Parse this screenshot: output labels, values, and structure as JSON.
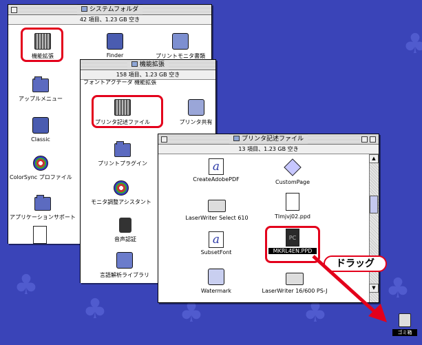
{
  "desktop": {
    "bg_color": "#3a44b8",
    "trash_label": "ゴミ箱"
  },
  "win_system": {
    "title": "システムフォルダ",
    "info": "42 項目、1.23 GB 空き",
    "items": {
      "kinou": "機能拡張",
      "finder": "Finder",
      "printmon": "プリントモニタ書類",
      "applemenu": "アップルメニュー",
      "classic": "Classic",
      "colorsync": "ColorSync プロファイル",
      "appsupport": "アプリケーションサポート"
    }
  },
  "win_ext": {
    "title": "機能拡張",
    "info": "158 項目、1.23 GB 空き",
    "partial_row": "フォントアクテーダ 機能拡張",
    "items": {
      "ppd": "プリンタ記述ファイル",
      "share": "プリンタ共有",
      "plugin": "プリントプラグイン",
      "monitor": "モニタ調整アシスタント",
      "voice": "音声認証",
      "lang": "言語解析ライブラリ"
    }
  },
  "win_ppd": {
    "title": "プリンタ記述ファイル",
    "info": "13 項目、1.23 GB 空き",
    "items": {
      "createadobe": "CreateAdobePDF",
      "custompage": "CustomPage",
      "lw610": "LaserWriter Select 610",
      "tlmjvj": "Tlmjvj02.ppd",
      "subset": "SubsetFont",
      "mkrl": "MKRL4EN.PPD",
      "watermark": "Watermark",
      "lw16600": "LaserWriter 16/600 PS-J"
    }
  },
  "callout": {
    "drag_label": "ドラッグ",
    "accent": "#e3001b"
  }
}
